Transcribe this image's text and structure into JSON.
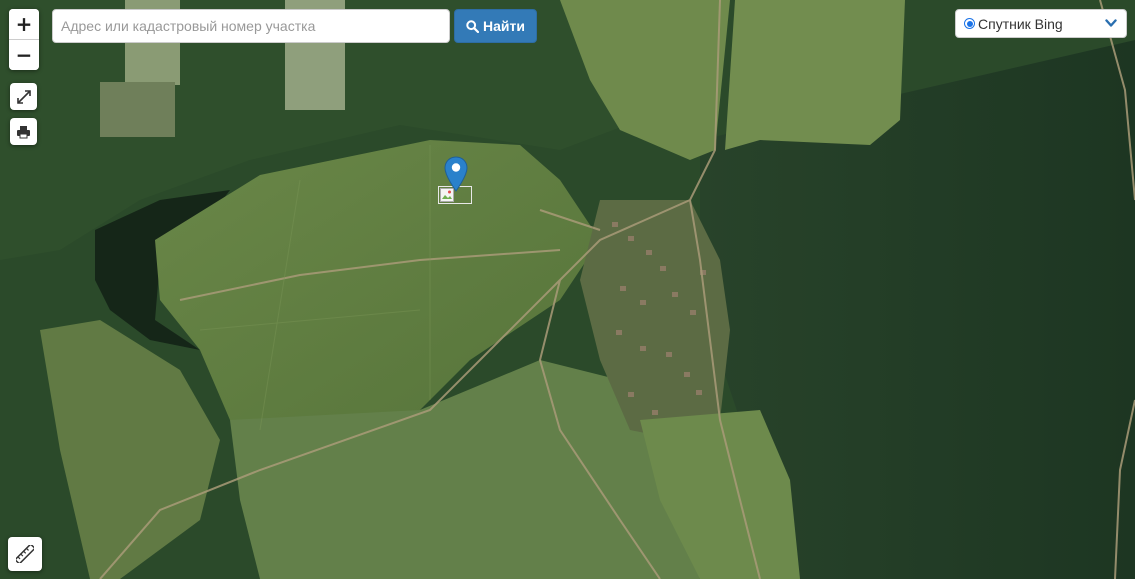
{
  "map": {
    "imagery": "satellite",
    "style": "aerial view of fields, forest and a small village",
    "colors": {
      "field": "#5b7a3a",
      "forest": "#1f3a1c",
      "water": "#182a1a",
      "road": "#a89a78",
      "marker": "#2a81cb"
    }
  },
  "controls": {
    "zoom_in_label": "+",
    "zoom_out_label": "−",
    "fullscreen_icon": "expand-arrows-icon",
    "print_icon": "printer-icon",
    "ruler_icon": "ruler-icon"
  },
  "search": {
    "placeholder": "Адрес или кадастровый номер участка",
    "value": "",
    "button_label": "Найти",
    "button_icon": "search-icon",
    "button_color": "#337ab7"
  },
  "layer_switcher": {
    "selected": "Спутник Bing",
    "icon": "chevron-down-icon"
  },
  "marker": {
    "icon": "map-pin-icon"
  }
}
